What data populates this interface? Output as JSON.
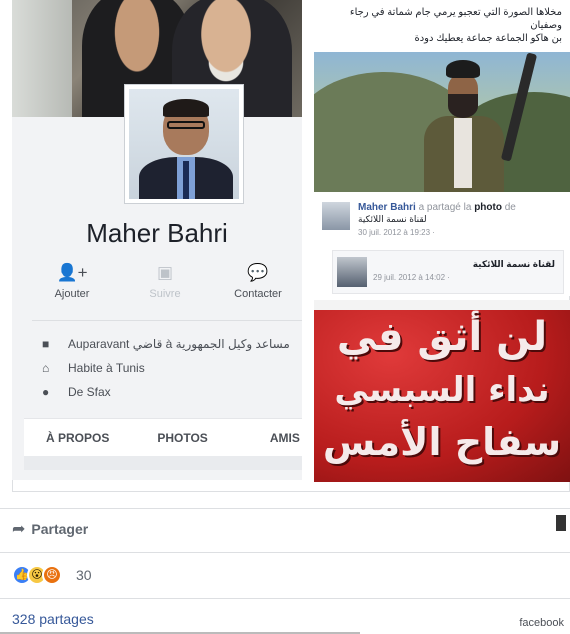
{
  "profile": {
    "name": "Maher Bahri",
    "actions": [
      {
        "label": "Ajouter",
        "icon": "add-friend-icon"
      },
      {
        "label": "Suivre",
        "icon": "follow-icon"
      },
      {
        "label": "Contacter",
        "icon": "messenger-icon"
      }
    ],
    "about": [
      {
        "icon": "briefcase-icon",
        "prefix": "Auparavant",
        "text": "قاضي à مساعد وكيل الجمهورية"
      },
      {
        "icon": "home-icon",
        "text": "Habite à Tunis"
      },
      {
        "icon": "location-pin-icon",
        "text": "De Sfax"
      }
    ],
    "tabs": [
      "À PROPOS",
      "PHOTOS",
      "AMIS"
    ]
  },
  "right_post": {
    "caption_line1": "مخلاها الصورة التي تعجبو يرمي جام شماتة في رجاء وصفيان",
    "caption_line2": "بن هاكو الجماعة جماعة يعطيك دودة",
    "share": {
      "name": "Maher Bahri",
      "action": "a partagé la",
      "object": "photo",
      "of": "de",
      "page": "لقناة نسمة اللائكية",
      "date": "30 juil. 2012 à 19:23 · "
    },
    "original": {
      "page": "لقناة نسمة اللائكية",
      "date": "29 juil. 2012 à 14:02 · "
    }
  },
  "poster": {
    "line1": "لن أثق في",
    "line2": "نداء السبسي",
    "line3": "سفاح الأمس"
  },
  "footer": {
    "share_label": "Partager",
    "reaction_count": "30",
    "shares": "328 partages",
    "watermark": "facebook"
  },
  "colors": {
    "link": "#365899",
    "like": "#3b7ff5",
    "poster_red": "#b71c1c"
  }
}
